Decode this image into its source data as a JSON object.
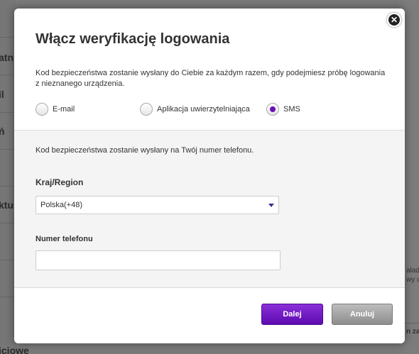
{
  "background": {
    "left_fragments": [
      "atn",
      "il",
      "ń",
      "ktu",
      "iciowe"
    ],
    "right_fragments": [
      "alad",
      "wy u",
      "n za"
    ]
  },
  "modal": {
    "title": "Włącz weryfikację logowania",
    "close_icon": "close-icon",
    "intro": "Kod bezpieczeństwa zostanie wysłany do Ciebie za każdym razem, gdy podejmiesz próbę logowania z nieznanego urządzenia.",
    "methods": [
      {
        "label": "E-mail",
        "checked": false
      },
      {
        "label": "Aplikacja uwierzytelniająca",
        "checked": false
      },
      {
        "label": "SMS",
        "checked": true
      }
    ],
    "sms": {
      "description": "Kod bezpieczeństwa zostanie wysłany na Twój numer telefonu.",
      "country_label": "Kraj/Region",
      "country_value": "Polska(+48)",
      "phone_label": "Numer telefonu",
      "phone_value": ""
    },
    "buttons": {
      "next": "Dalej",
      "cancel": "Anuluj"
    }
  },
  "colors": {
    "accent": "#6a0fb8",
    "primary_button": "#5d0bb0",
    "secondary_button": "#8d8d8d"
  }
}
